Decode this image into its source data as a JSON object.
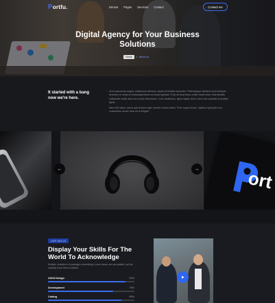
{
  "colors": {
    "accent": "#3a6df0",
    "background": "#16171b",
    "text_muted": "#8e909a"
  },
  "nav": {
    "logo": "ortfu.",
    "logo_letter": "P",
    "menu": [
      "Demos",
      "Pages",
      "Services",
      "Contact"
    ],
    "contact_button": "Contact me"
  },
  "hero": {
    "title": "Digital Agency for Your Business Solutions",
    "breadcrumb": {
      "home": "Home",
      "separator": "/",
      "current": "About us"
    }
  },
  "intro": {
    "heading": "It started with a bang now we're here.",
    "paragraph_1": "Ut id maecenas magna, vestibulum interdum sapien et facilisis imperdiet. Pellentesque habitant morbi tristique senectus et netus et malesuada fames ac turpis egestas. Proin sit amet lacus mollis turpis tortor, fella facilisis sollicitudin mollis diam non nullus elementum. Cras vestibulum, ligula sapien dolor lorem est vulputate at facilisis ligula.",
    "paragraph_2": "Nam nibh diam, varius quis tempus eget, laoreet cursus metus. Proin augue lectus, dapibus eget justo nec, consectetur auctor risus sit ut fringilla."
  },
  "gallery": {
    "prev_icon": "arrow-left-icon",
    "next_icon": "arrow-right-icon",
    "prev_glyph": "←",
    "next_glyph": "→",
    "brand_text": "ort"
  },
  "skills": {
    "badge": "OUR SKILLS",
    "title": "Display Your Skills For The World To Acknowledge",
    "description": "Multiple variations of packages resembling Lorem Ipsum are acceptable, yet the majority have been modified.",
    "items": [
      {
        "label": "UX/UI Design",
        "percent": "90%",
        "value": 0.9
      },
      {
        "label": "Development",
        "percent": "75%",
        "value": 0.75
      },
      {
        "label": "Coding",
        "percent": "85%",
        "value": 0.85
      }
    ],
    "play_icon": "play-icon"
  }
}
